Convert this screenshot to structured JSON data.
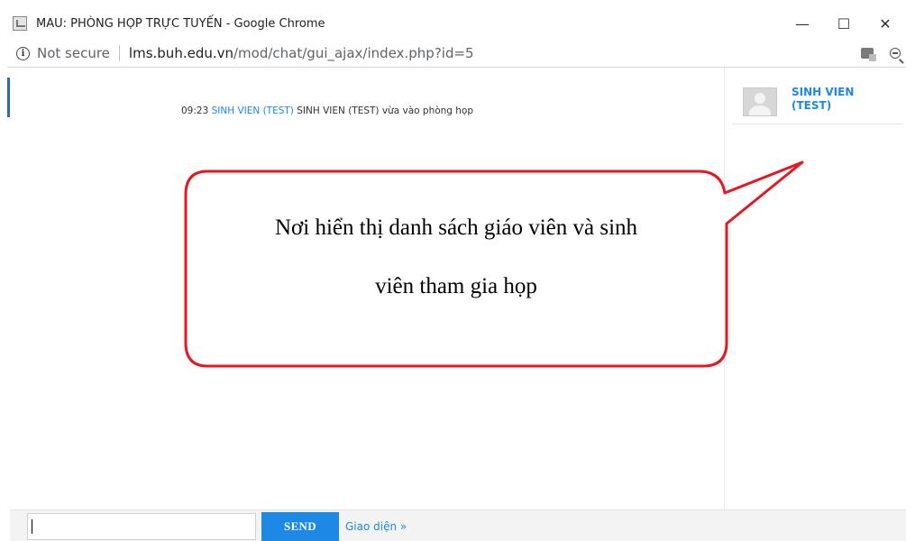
{
  "window": {
    "title": "MAU: PHÒNG HỌP TRỰC TUYẾN - Google Chrome",
    "controls": {
      "minimize": "—",
      "maximize": "☐",
      "close": "✕"
    },
    "app_icon": "page-icon"
  },
  "address_bar": {
    "security_label": "Not secure",
    "url_host": "lms.buh.edu.vn",
    "url_path": "/mod/chat/gui_ajax/index.php?id=5",
    "icons": [
      "info-icon",
      "translate-icon",
      "zoom-out-icon"
    ]
  },
  "chat": {
    "messages": [
      {
        "time": "09:23",
        "user": "SINH VIEN (TEST)",
        "text": "SINH VIEN (TEST) vừa vào phòng họp"
      }
    ]
  },
  "users_panel": {
    "users": [
      {
        "name": "SINH VIEN (TEST)",
        "avatar": "default-avatar"
      }
    ]
  },
  "callout": {
    "line1": "Nơi hiển thị danh sách giáo viên và sinh",
    "line2": "viên tham gia họp",
    "border_color": "#e8161e"
  },
  "composer": {
    "input_value": "",
    "send_label": "SEND",
    "theme_link": "Giao diện »"
  },
  "colors": {
    "accent": "#1e88e5",
    "callout_border": "#e8161e"
  }
}
